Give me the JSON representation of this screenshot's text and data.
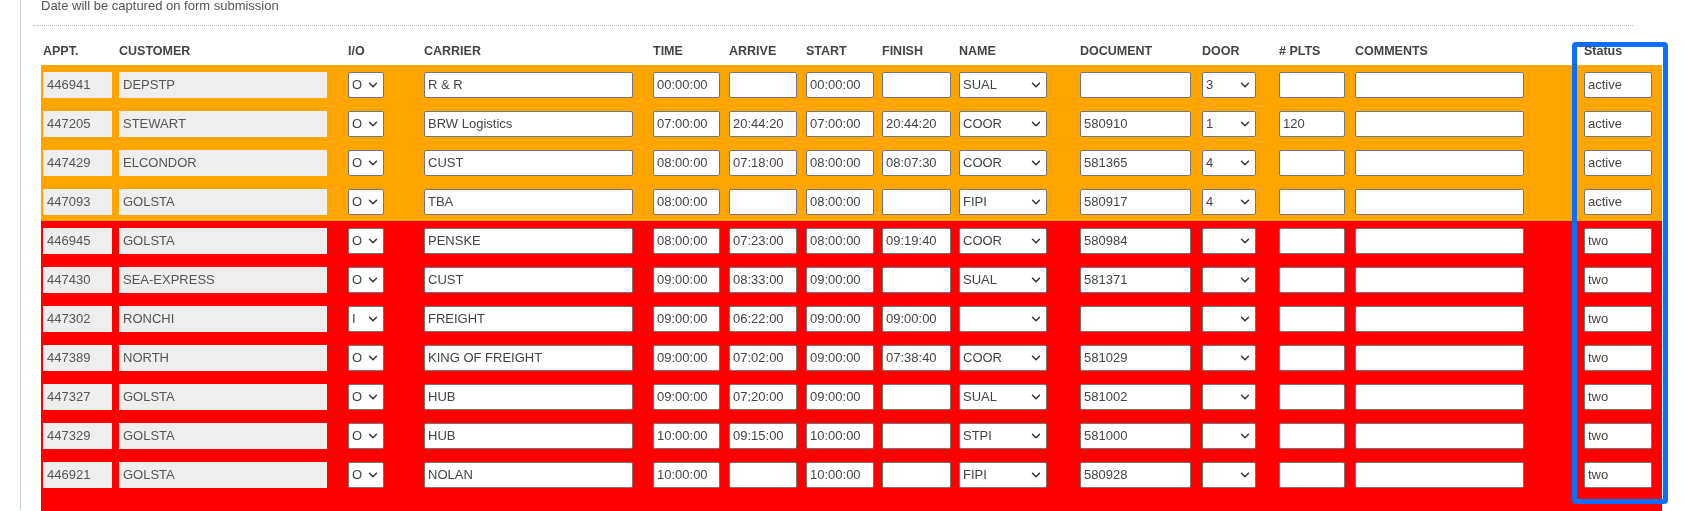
{
  "note": "Date will be captured on form submission",
  "table": {
    "columns": [
      "APPT.",
      "CUSTOMER",
      "I/O",
      "CARRIER",
      "TIME",
      "ARRIVE",
      "START",
      "FINISH",
      "NAME",
      "DOCUMENT",
      "DOOR",
      "# PLTS",
      "COMMENTS",
      "Status"
    ],
    "groups": [
      {
        "color": "#ffa500",
        "rows": [
          {
            "appt": "446941",
            "customer": "DEPSTP",
            "io": "O",
            "carrier": "R & R",
            "time": "00:00:00",
            "start": "00:00:00",
            "name": "SUAL",
            "door": "3",
            "status": "active"
          },
          {
            "appt": "447205",
            "customer": "STEWART",
            "io": "O",
            "carrier": "BRW Logistics",
            "time": "07:00:00",
            "arrive": "20:44:20",
            "start": "07:00:00",
            "finish": "20:44:20",
            "name": "COOR",
            "document": "580910",
            "door": "1",
            "plts": "120",
            "status": "active"
          },
          {
            "appt": "447429",
            "customer": "ELCONDOR",
            "io": "O",
            "carrier": "CUST",
            "time": "08:00:00",
            "arrive": "07:18:00",
            "start": "08:00:00",
            "finish": "08:07:30",
            "name": "COOR",
            "document": "581365",
            "door": "4",
            "status": "active"
          },
          {
            "appt": "447093",
            "customer": "GOLSTA",
            "io": "O",
            "carrier": "TBA",
            "time": "08:00:00",
            "start": "08:00:00",
            "name": "FIPI",
            "document": "580917",
            "door": "4",
            "status": "active"
          }
        ]
      },
      {
        "color": "#ff0000",
        "rows": [
          {
            "appt": "446945",
            "customer": "GOLSTA",
            "io": "O",
            "carrier": "PENSKE",
            "time": "08:00:00",
            "arrive": "07:23:00",
            "start": "08:00:00",
            "finish": "09:19:40",
            "name": "COOR",
            "document": "580984",
            "status": "two"
          },
          {
            "appt": "447430",
            "customer": "SEA-EXPRESS",
            "io": "O",
            "carrier": "CUST",
            "time": "09:00:00",
            "arrive": "08:33:00",
            "start": "09:00:00",
            "name": "SUAL",
            "document": "581371",
            "status": "two"
          },
          {
            "appt": "447302",
            "customer": "RONCHI",
            "io": "I",
            "carrier": "FREIGHT",
            "time": "09:00:00",
            "arrive": "06:22:00",
            "start": "09:00:00",
            "finish": "09:00:00",
            "status": "two"
          },
          {
            "appt": "447389",
            "customer": "NORTH",
            "io": "O",
            "carrier": "KING OF FREIGHT",
            "time": "09:00:00",
            "arrive": "07:02:00",
            "start": "09:00:00",
            "finish": "07:38:40",
            "name": "COOR",
            "document": "581029",
            "status": "two"
          },
          {
            "appt": "447327",
            "customer": "GOLSTA",
            "io": "O",
            "carrier": "HUB",
            "time": "09:00:00",
            "arrive": "07:20:00",
            "start": "09:00:00",
            "name": "SUAL",
            "document": "581002",
            "status": "two"
          },
          {
            "appt": "447329",
            "customer": "GOLSTA",
            "io": "O",
            "carrier": "HUB",
            "time": "10:00:00",
            "arrive": "09:15:00",
            "start": "10:00:00",
            "name": "STPI",
            "document": "581000",
            "status": "two"
          },
          {
            "appt": "446921",
            "customer": "GOLSTA",
            "io": "O",
            "carrier": "NOLAN",
            "time": "10:00:00",
            "start": "10:00:00",
            "name": "FIPI",
            "document": "580928",
            "status": "two"
          }
        ]
      }
    ]
  }
}
